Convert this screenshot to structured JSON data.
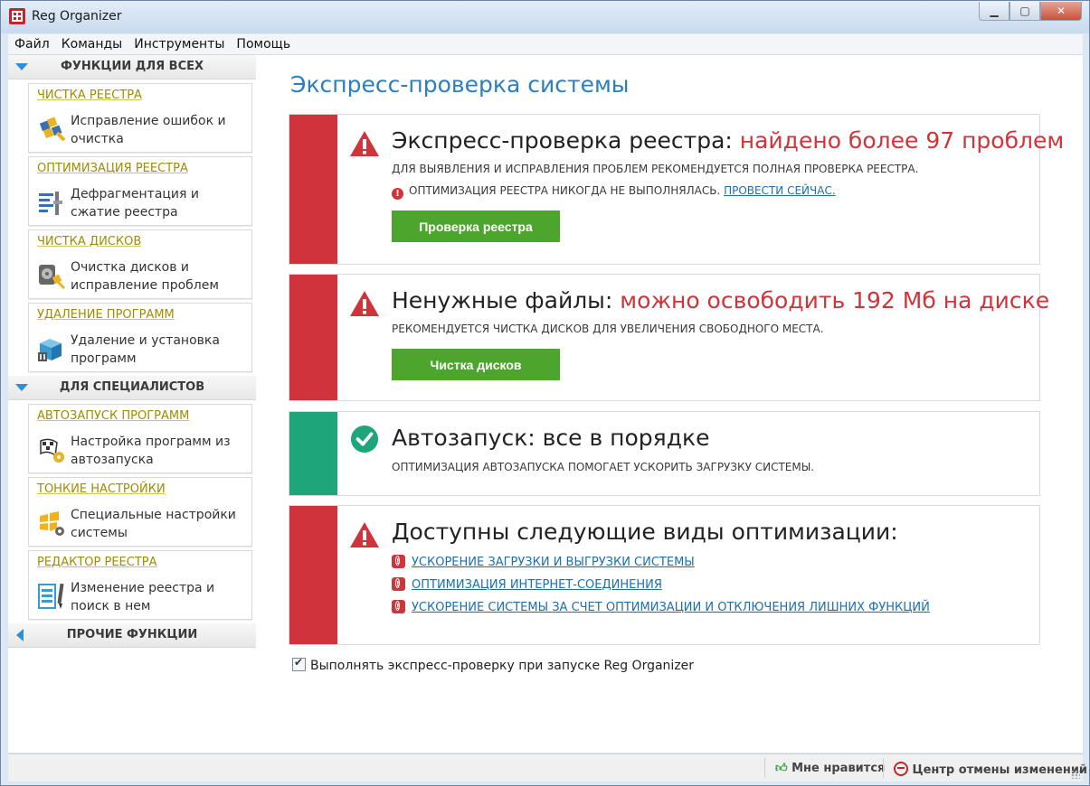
{
  "window": {
    "title": "Reg Organizer"
  },
  "menu": [
    "Файл",
    "Команды",
    "Инструменты",
    "Помощь"
  ],
  "sidebar": {
    "section_all": "ФУНКЦИИ ДЛЯ ВСЕХ",
    "section_pro": "ДЛЯ СПЕЦИАЛИСТОВ",
    "section_other": "ПРОЧИЕ ФУНКЦИИ",
    "cards": [
      {
        "title": "ЧИСТКА РЕЕСТРА",
        "desc": "Исправление ошибок и очистка",
        "icon": "registry-clean-icon"
      },
      {
        "title": "ОПТИМИЗАЦИЯ РЕЕСТРА",
        "desc": "Дефрагментация и сжатие реестра",
        "icon": "registry-defrag-icon"
      },
      {
        "title": "ЧИСТКА ДИСКОВ",
        "desc": "Очистка дисков и исправление проблем",
        "icon": "disk-clean-icon"
      },
      {
        "title": "УДАЛЕНИЕ ПРОГРАММ",
        "desc": "Удаление и установка программ",
        "icon": "uninstall-icon"
      },
      {
        "title": "АВТОЗАПУСК ПРОГРАММ",
        "desc": "Настройка программ из автозапуска",
        "icon": "autorun-icon"
      },
      {
        "title": "ТОНКИЕ НАСТРОЙКИ",
        "desc": "Специальные настройки системы",
        "icon": "tweaks-icon"
      },
      {
        "title": "РЕДАКТОР РЕЕСТРА",
        "desc": "Изменение реестра и поиск в нем",
        "icon": "registry-editor-icon"
      }
    ]
  },
  "main": {
    "title": "Экспресс-проверка системы",
    "registry": {
      "head": "Экспресс-проверка реестра: ",
      "highlight": "найдено более 97 проблем",
      "line1": "Для выявления и исправления проблем рекомендуется полная проверка реестра.",
      "line2": "Оптимизация реестра никогда не выполнялась. ",
      "line2_link": "Провести сейчас.",
      "button": "Проверка реестра"
    },
    "junk": {
      "head": "Ненужные файлы: ",
      "highlight": "можно освободить 192 Мб на диске",
      "line1": "Рекомендуется чистка дисков для увеличения свободного места.",
      "button": "Чистка дисков"
    },
    "autorun": {
      "head": "Автозапуск: все в порядке",
      "line1": "Оптимизация автозапуска помогает ускорить загрузку системы."
    },
    "optim": {
      "head": "Доступны следующие виды оптимизации:",
      "links": [
        "Ускорение загрузки и выгрузки системы",
        "Оптимизация интернет-соединения",
        "Ускорение системы за счет оптимизации и отключения лишних функций"
      ]
    },
    "startup_check_label": "Выполнять экспресс-проверку при запуске Reg Organizer"
  },
  "statusbar": {
    "like": "Мне нравится",
    "undo_center": "Центр отмены изменений"
  },
  "colors": {
    "alert": "#d0343a",
    "ok": "#1ea57a",
    "button": "#4ea52e",
    "title_blue": "#2a7fc4",
    "card_title": "#9e8d00"
  }
}
